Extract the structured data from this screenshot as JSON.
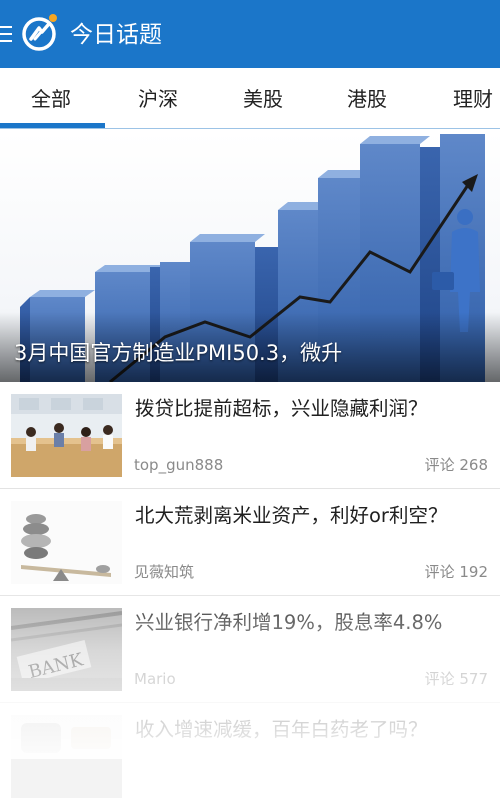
{
  "appbar": {
    "title": "今日话题",
    "menu_icon": "menu-icon",
    "logo_icon": "app-logo-icon",
    "accent_color": "#1b76c9",
    "logo_dot_color": "#f5a623"
  },
  "tabs": [
    {
      "label": "全部",
      "selected": true
    },
    {
      "label": "沪深",
      "selected": false
    },
    {
      "label": "美股",
      "selected": false
    },
    {
      "label": "港股",
      "selected": false
    },
    {
      "label": "理财",
      "selected": false
    }
  ],
  "hero": {
    "caption": "3月中国官方制造业PMI50.3，微升",
    "image": "rising-bar-chart-businessman-image"
  },
  "articles": [
    {
      "title": "拨贷比提前超标，兴业隐藏利润？",
      "author": "top_gun888",
      "comments": "评论 268",
      "image": "bank-lobby-photo"
    },
    {
      "title": "北大荒剥离米业资产，利好or利空？",
      "author": "见薇知筑",
      "comments": "评论 192",
      "image": "balancing-stones-photo"
    },
    {
      "title": "兴业银行净利增19%，股息率4.8%",
      "author": "Mario",
      "comments": "评论 577",
      "image": "bank-sign-photo"
    },
    {
      "title": "收入增速减缓，百年白药老了吗？",
      "author": "",
      "comments": "",
      "image": "medicine-photo"
    }
  ]
}
